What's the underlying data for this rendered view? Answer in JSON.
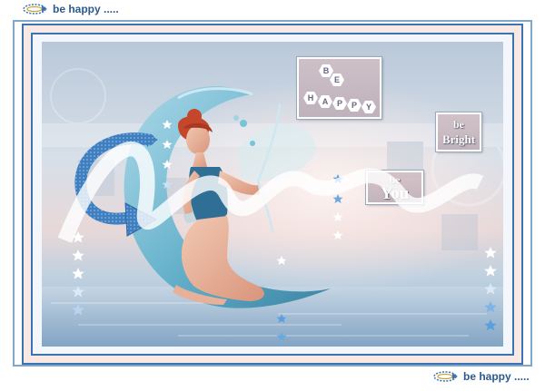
{
  "captions": {
    "top": "be happy .....",
    "bottom": "be happy ....."
  },
  "tags": {
    "be_happy": {
      "letters": [
        "B",
        "E",
        "H",
        "A",
        "P",
        "P",
        "Y"
      ]
    },
    "be_bright": {
      "line1": "be",
      "line2": "Bright"
    },
    "be_you": {
      "line1": "be",
      "line2": "You"
    }
  },
  "watermark": "Calligraphy signature",
  "colors": {
    "frame_blue": "#3c74b3",
    "caption_blue": "#2c5a8c",
    "mat_pink": "#f8e9e4",
    "arrow_blue": "#3f7fc0",
    "star_blue": "#5aa0de",
    "hair_red": "#c4472b"
  },
  "icons": {
    "caption_swirl": "swirl-arrow-icon",
    "decor_arrow": "curved-arrow-icon",
    "decor_star": "star-icon"
  }
}
